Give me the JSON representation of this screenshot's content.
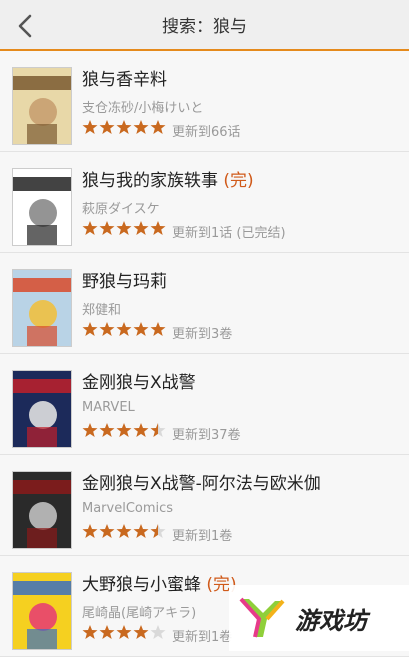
{
  "header": {
    "title": "搜索：狼与"
  },
  "results": [
    {
      "name": "狼与香辛料",
      "tag": "",
      "author": "支仓冻砂/小梅けいと",
      "rating": 5,
      "update": "更新到66话"
    },
    {
      "name": "狼与我的家族轶事",
      "tag": " (完)",
      "author": "萩原ダイスケ",
      "rating": 5,
      "update": "更新到1话 (已完结)"
    },
    {
      "name": "野狼与玛莉",
      "tag": "",
      "author": "郑健和",
      "rating": 5,
      "update": "更新到3卷"
    },
    {
      "name": "金刚狼与X战警",
      "tag": "",
      "author": "MARVEL",
      "rating": 4.5,
      "update": "更新到37卷"
    },
    {
      "name": "金刚狼与X战警-阿尔法与欧米伽",
      "tag": "",
      "author": "MarvelComics",
      "rating": 4.5,
      "update": "更新到1卷"
    },
    {
      "name": "大野狼与小蜜蜂",
      "tag": " (完)",
      "author": "尾崎晶(尾崎アキラ)",
      "rating": 4,
      "update": "更新到1卷"
    }
  ],
  "watermark": {
    "text": "游戏坊"
  },
  "colors": {
    "accent": "#e58a1c",
    "star": "#c9691f",
    "tag": "#d05a1a"
  }
}
